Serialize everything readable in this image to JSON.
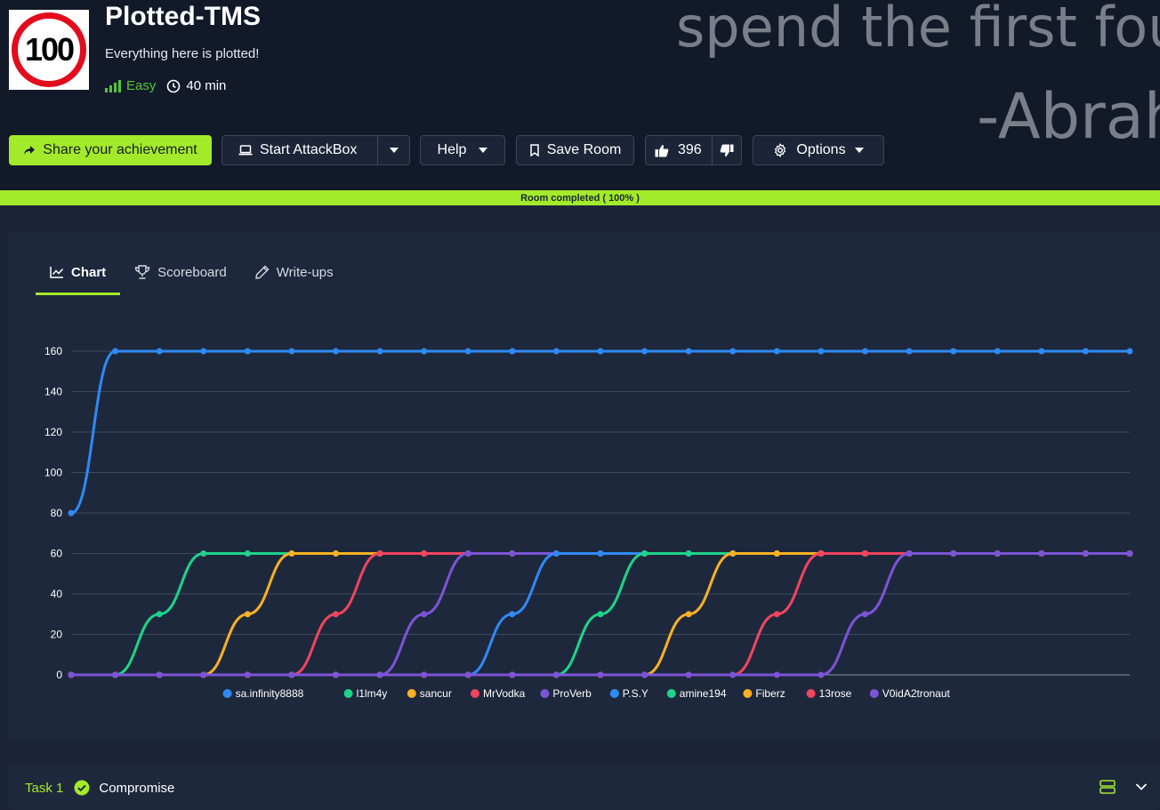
{
  "header": {
    "quote_line1": "spend the first fou",
    "quote_line2": "-Abrah",
    "logo_text": "100",
    "title": "Plotted-TMS",
    "subtitle": "Everything here is plotted!",
    "difficulty": "Easy",
    "duration": "40 min"
  },
  "toolbar": {
    "share_label": "Share your achievement",
    "attackbox_label": "Start AttackBox",
    "help_label": "Help",
    "save_label": "Save Room",
    "likes": "396",
    "options_label": "Options"
  },
  "progress": {
    "label": "Room completed ( 100% )",
    "value": 100
  },
  "tabs": [
    {
      "label": "Chart",
      "active": true
    },
    {
      "label": "Scoreboard",
      "active": false
    },
    {
      "label": "Write-ups",
      "active": false
    }
  ],
  "chart_data": {
    "type": "line",
    "y_ticks": [
      "0",
      "20",
      "40",
      "60",
      "80",
      "100",
      "120",
      "140",
      "160"
    ],
    "ylim": [
      0,
      160
    ],
    "grid": true,
    "legend_position": "bottom",
    "points_per_series": 25,
    "series": [
      {
        "name": "sa.infinity8888",
        "color": "#2f8af5",
        "values": [
          80,
          160,
          160,
          160,
          160,
          160,
          160,
          160,
          160,
          160,
          160,
          160,
          160,
          160,
          160,
          160,
          160,
          160,
          160,
          160,
          160,
          160,
          160,
          160,
          160
        ]
      },
      {
        "name": "l1lm4y",
        "color": "#1fd38a",
        "values": [
          0,
          0,
          30,
          60,
          60,
          60,
          60,
          60,
          60,
          60,
          60,
          60,
          60,
          60,
          60,
          60,
          60,
          60,
          60,
          60,
          60,
          60,
          60,
          60,
          60
        ]
      },
      {
        "name": "sancur",
        "color": "#f8b124",
        "values": [
          0,
          0,
          0,
          0,
          30,
          60,
          60,
          60,
          60,
          60,
          60,
          60,
          60,
          60,
          60,
          60,
          60,
          60,
          60,
          60,
          60,
          60,
          60,
          60,
          60
        ]
      },
      {
        "name": "MrVodka",
        "color": "#f1445e",
        "values": [
          0,
          0,
          0,
          0,
          0,
          0,
          30,
          60,
          60,
          60,
          60,
          60,
          60,
          60,
          60,
          60,
          60,
          60,
          60,
          60,
          60,
          60,
          60,
          60,
          60
        ]
      },
      {
        "name": "ProVerb",
        "color": "#7c54d8",
        "values": [
          0,
          0,
          0,
          0,
          0,
          0,
          0,
          0,
          30,
          60,
          60,
          60,
          60,
          60,
          60,
          60,
          60,
          60,
          60,
          60,
          60,
          60,
          60,
          60,
          60
        ]
      },
      {
        "name": "P.S.Y",
        "color": "#2f8af5",
        "values": [
          0,
          0,
          0,
          0,
          0,
          0,
          0,
          0,
          0,
          0,
          30,
          60,
          60,
          60,
          60,
          60,
          60,
          60,
          60,
          60,
          60,
          60,
          60,
          60,
          60
        ]
      },
      {
        "name": "amine194",
        "color": "#1fd38a",
        "values": [
          0,
          0,
          0,
          0,
          0,
          0,
          0,
          0,
          0,
          0,
          0,
          0,
          30,
          60,
          60,
          60,
          60,
          60,
          60,
          60,
          60,
          60,
          60,
          60,
          60
        ]
      },
      {
        "name": "Fiberz",
        "color": "#f8b124",
        "values": [
          0,
          0,
          0,
          0,
          0,
          0,
          0,
          0,
          0,
          0,
          0,
          0,
          0,
          0,
          30,
          60,
          60,
          60,
          60,
          60,
          60,
          60,
          60,
          60,
          60
        ]
      },
      {
        "name": "13rose",
        "color": "#f1445e",
        "values": [
          0,
          0,
          0,
          0,
          0,
          0,
          0,
          0,
          0,
          0,
          0,
          0,
          0,
          0,
          0,
          0,
          30,
          60,
          60,
          60,
          60,
          60,
          60,
          60,
          60
        ]
      },
      {
        "name": "V0idA2tronaut",
        "color": "#7c54d8",
        "values": [
          0,
          0,
          0,
          0,
          0,
          0,
          0,
          0,
          0,
          0,
          0,
          0,
          0,
          0,
          0,
          0,
          0,
          0,
          30,
          60,
          60,
          60,
          60,
          60,
          60
        ]
      }
    ]
  },
  "task": {
    "number": "Task 1",
    "title": "Compromise"
  },
  "icons": {
    "share": "share-icon",
    "laptop": "laptop-icon",
    "bookmark": "bookmark-icon",
    "thumbs_up": "thumbs-up-icon",
    "thumbs_down": "thumbs-down-icon",
    "gear": "gear-icon",
    "clock": "clock-icon",
    "chart": "chart-icon",
    "trophy": "trophy-icon",
    "pencil": "pencil-icon"
  }
}
